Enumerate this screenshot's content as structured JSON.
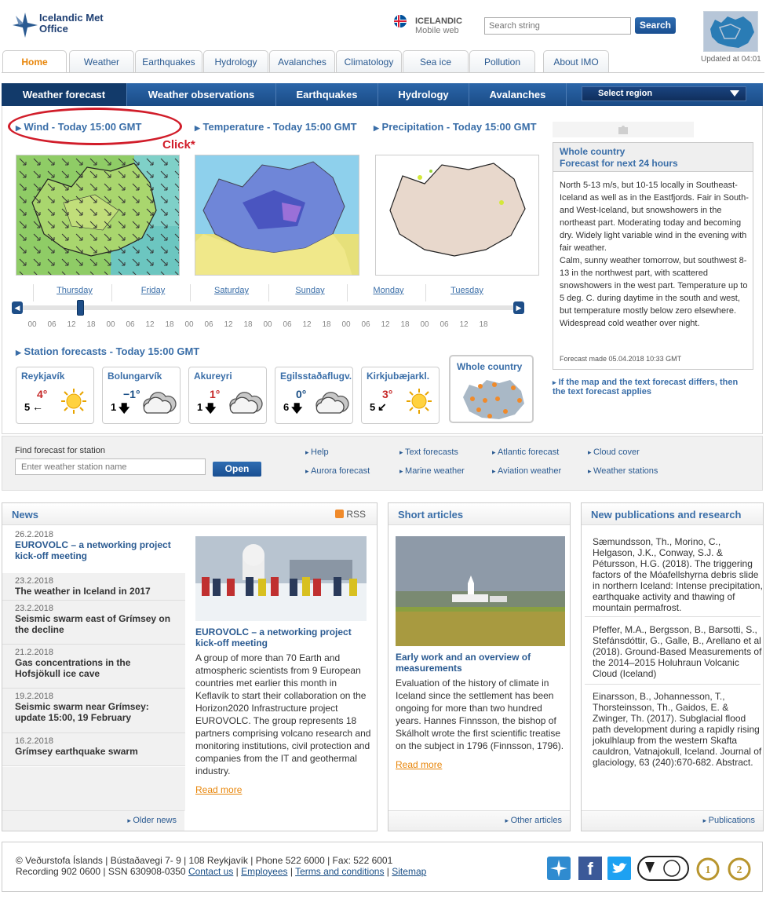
{
  "header": {
    "logo_line1": "Icelandic Met",
    "logo_line2": "Office",
    "lang_label": "ICELANDIC",
    "mobile_label": "Mobile web",
    "search_placeholder": "Search string",
    "search_button": "Search",
    "updated": "Updated at 04:01"
  },
  "top_tabs": [
    "Home",
    "Weather",
    "Earthquakes",
    "Hydrology",
    "Avalanches",
    "Climatology",
    "Sea ice",
    "Pollution",
    "About IMO"
  ],
  "blue_tabs": [
    "Weather forecast",
    "Weather observations",
    "Earthquakes",
    "Hydrology",
    "Avalanches"
  ],
  "region_select": "Select region",
  "maps": {
    "wind_title": "Wind - Today 15:00 GMT",
    "temp_title": "Temperature - Today 15:00 GMT",
    "precip_title": "Precipitation - Today 15:00 GMT",
    "annotation": "Click*"
  },
  "timeline": {
    "days": [
      "Thursday",
      "Friday",
      "Saturday",
      "Sunday",
      "Monday",
      "Tuesday"
    ],
    "hours": [
      "00",
      "06",
      "12",
      "18"
    ]
  },
  "stations_title": "Station forecasts - Today 15:00 GMT",
  "stations": [
    {
      "name": "Reykjavík",
      "temp": "4°",
      "temp_color": "#c62828",
      "wind": "5",
      "arrow": "←",
      "sky": "sun"
    },
    {
      "name": "Bolungarvík",
      "temp": "−1°",
      "temp_color": "#1a4f86",
      "wind": "1",
      "arrow": "🡇",
      "sky": "cloud"
    },
    {
      "name": "Akureyri",
      "temp": "1°",
      "temp_color": "#c62828",
      "wind": "1",
      "arrow": "🡇",
      "sky": "cloud"
    },
    {
      "name": "Egilsstaðaflugv.",
      "temp": "0°",
      "temp_color": "#1a4f86",
      "wind": "6",
      "arrow": "🡇",
      "sky": "cloud"
    },
    {
      "name": "Kirkjubæjarkl.",
      "temp": "3°",
      "temp_color": "#c62828",
      "wind": "5",
      "arrow": "↙",
      "sky": "sun"
    }
  ],
  "whole_country_label": "Whole country",
  "text_forecast": {
    "head1": "Whole country",
    "head2": "Forecast for next 24 hours",
    "body": "North 5-13 m/s, but 10-15 locally in Southeast-Iceland as well as in the Eastfjords. Fair in South- and West-Iceland, but snowshowers in the northeast part. Moderating today and becoming dry. Widely light variable wind in the evening with fair weather.",
    "body2": "Calm, sunny weather tomorrow, but southwest 8-13 in the northwest part, with scattered snowshowers in the west part. Temperature up to 5 deg. C. during daytime in the south and west, but temperature mostly below zero elsewhere. Widespread cold weather over night.",
    "made": "Forecast made 05.04.2018 10:33 GMT",
    "note": "If the map and the text forecast differs, then the text forecast applies"
  },
  "find": {
    "label": "Find forecast for station",
    "placeholder": "Enter weather station name",
    "button": "Open"
  },
  "quick_links": [
    "Help",
    "Aurora forecast",
    "Text forecasts",
    "Marine weather",
    "Atlantic forecast",
    "Aviation weather",
    "Cloud cover",
    "Weather stations"
  ],
  "news": {
    "title": "News",
    "rss": "RSS",
    "items": [
      {
        "date": "26.2.2018",
        "title": "EUROVOLC – a networking project kick-off meeting"
      },
      {
        "date": "23.2.2018",
        "title": "The weather in Iceland in 2017"
      },
      {
        "date": "23.2.2018",
        "title": "Seismic swarm east of Grímsey on the decline"
      },
      {
        "date": "21.2.2018",
        "title": "Gas concentrations in the Hofsjökull ice cave"
      },
      {
        "date": "19.2.2018",
        "title": "Seismic swarm near Grímsey: update 15:00, 19 February"
      },
      {
        "date": "16.2.2018",
        "title": "Grímsey earthquake swarm"
      }
    ],
    "feature_title": "EUROVOLC – a networking project kick-off meeting",
    "feature_body": "A group of more than 70 Earth and atmospheric scientists from 9 European countries met earlier this month in Keflavík to start their collaboration on the Horizon2020 Infrastructure project EUROVOLC. The group represents 18 partners comprising volcano research and monitoring institutions, civil protection and companies from the IT and geothermal industry.",
    "read_more": "Read more",
    "older": "Older news"
  },
  "short_articles": {
    "title": "Short articles",
    "feature_title": "Early work and an overview of measurements",
    "feature_body": "Evaluation of the history of climate in Iceland since the settlement has been ongoing for more than two hundred years. Hannes Finnsson, the bishop of Skálholt wrote the first scientific treatise on the subject in 1796 (Finnsson, 1796).",
    "read_more": "Read more",
    "other": "Other articles"
  },
  "publications": {
    "title": "New publications and research",
    "items": [
      "Sæmundsson, Th., Morino, C., Helgason, J.K., Conway, S.J. & Pétursson, H.G. (2018). The triggering factors of the Móafellshyrna debris slide in northern Iceland: Intense precipitation, earthquake activity and thawing of mountain permafrost.",
      "Pfeffer, M.A., Bergsson, B., Barsotti, S., Stefánsdóttir, G., Galle, B., Arellano et al (2018). Ground-Based Measurements of the 2014–2015 Holuhraun Volcanic Cloud (Iceland)",
      "Einarsson, B., Johannesson, T., Thorsteinsson, Th., Gaidos, E. & Zwinger, Th. (2017). Subglacial flood path development during a rapidly rising jokulhlaup from the western Skafta cauldron, Vatnajokull, Iceland. Journal of glaciology, 63 (240):670-682. Abstract."
    ],
    "more": "Publications"
  },
  "footer": {
    "line1": "© Veðurstofa Íslands | Bústaðavegi 7- 9 | 108 Reykjavík | Phone 522 6000 | Fax: 522 6001",
    "line2_prefix": "Recording 902 0600 | SSN 630908-0350 ",
    "links": [
      "Contact us",
      "Employees",
      "Terms and conditions",
      "Sitemap"
    ]
  }
}
